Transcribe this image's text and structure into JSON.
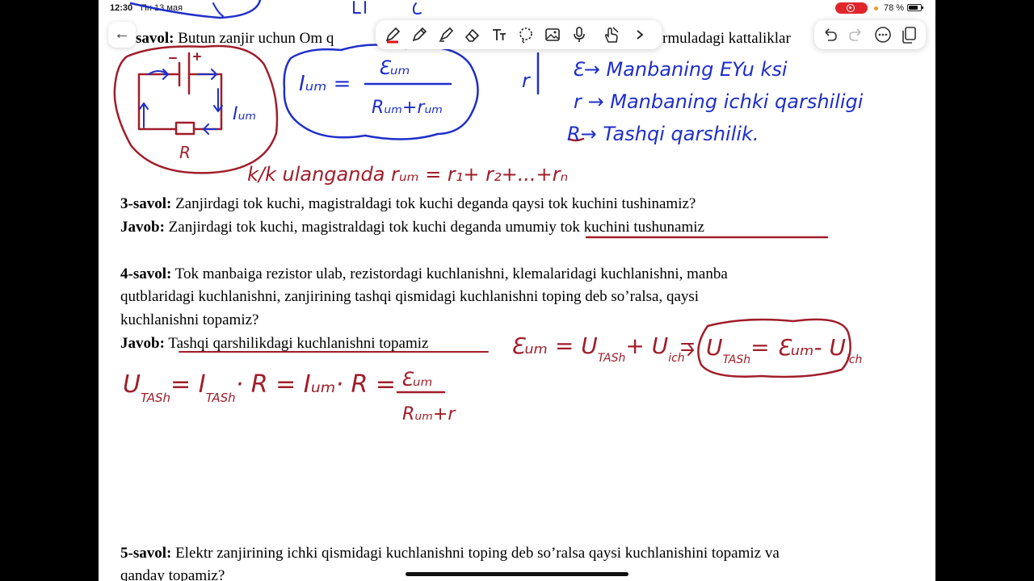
{
  "status": {
    "time": "12:30",
    "date": "Пн 13 мая",
    "battery": "78 %",
    "battery_level": 0.78
  },
  "doc": {
    "q2_label": "savol:",
    "q2_text": " Butun zanjir uchun Om q",
    "q2_text_tail": "rmuladagi kattaliklar",
    "q3_label": "3-savol:",
    "q3_text": " Zanjirdagi tok kuchi, magistraldagi tok kuchi deganda qaysi tok kuchini tushinamiz?",
    "a3_label": "Javob:",
    "a3_text": " Zanjirdagi tok kuchi, magistraldagi tok kuchi deganda umumiy tok kuchini tushunamiz",
    "q4_label": "4-savol:",
    "q4_line1": " Tok manbaiga rezistor ulab, rezistordagi kuchlanishni, klemalaridagi kuchlanishni, manba",
    "q4_line2": "qutblaridagi kuchlanishni, zanjirining tashqi qismidagi kuchlanishni   toping deb so’ralsa, qaysi",
    "q4_line3": "kuchlanishni topamiz?",
    "a4_label": "Javob:",
    "a4_text": " Tashqi qarshilikdagi kuchlanishni topamiz",
    "q5_label": "5-savol:",
    "q5_line1": " Elektr zanjirining ichki qismidagi kuchlanishni toping deb so’ralsa qaysi kuchlanishini topamiz va",
    "q5_line2": "qanday topamiz?"
  },
  "handwriting": {
    "circuit_current": "Iᵤₘ",
    "circuit_resistor": "R",
    "formula_left": "Iᵤₘ =",
    "formula_num": "Ɛᵤₘ",
    "formula_den": "Rᵤₘ+rᵤₘ",
    "legend_1": "Ɛ→ Manbaning EYu ksi",
    "legend_2": "r → Manbaning ichki qarshiligi",
    "legend_3": "R→ Tashqi qarshilik.",
    "series_note": "k/k ulanganda  rᵤₘ = r₁+ r₂+...+rₙ",
    "eq_emf": "Ɛᵤₘ = U",
    "eq_emf_sub": "TASh",
    "eq_emf_plus": "+ U",
    "eq_emf_sub2": "ich",
    "eq_boxed": "U",
    "eq_boxed_sub": "TASh",
    "eq_boxed_rest": "= Ɛᵤₘ- U",
    "eq_boxed_sub2": "ich",
    "u_line": "U",
    "u_line_sub": "TASh",
    "u_line_mid": "= I",
    "u_line_sub2": "TASh",
    "u_line_rest": "· R = Iᵤₘ· R =",
    "u_frac_num": "Ɛᵤₘ",
    "u_frac_den": "Rᵤₘ+r",
    "side_mark": "r"
  },
  "colors": {
    "ink_red": "#a01e2a",
    "ink_blue": "#1f2fc9",
    "ink_black": "#111111",
    "record": "#e0262b"
  },
  "toolbar": {
    "back_icon": "back-arrow-icon",
    "tools": [
      "pen-icon",
      "pencil-icon",
      "highlighter-icon",
      "eraser-icon",
      "text-tool-icon",
      "lasso-icon",
      "image-icon",
      "microphone-icon",
      "hand-touch-icon",
      "chevron-right-icon"
    ],
    "right_tools": [
      "undo-icon",
      "redo-icon",
      "more-icon",
      "pages-icon"
    ]
  }
}
